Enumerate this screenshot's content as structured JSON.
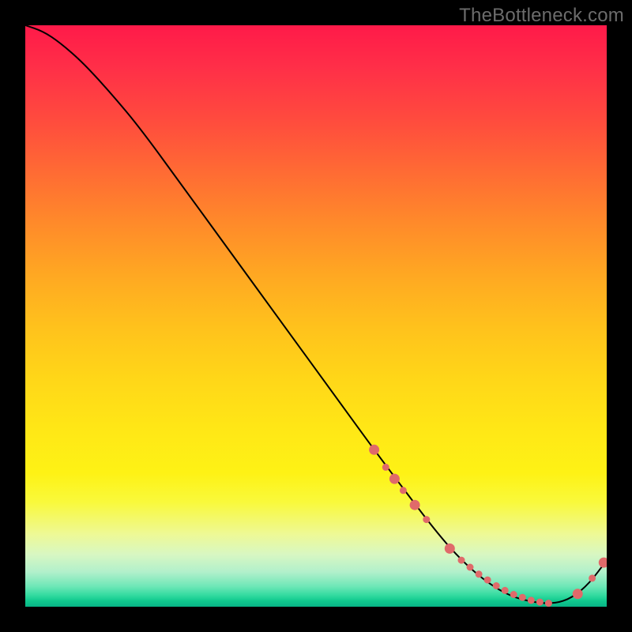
{
  "watermark": "TheBottleneck.com",
  "chart_data": {
    "type": "line",
    "title": "",
    "xlabel": "",
    "ylabel": "",
    "xlim": [
      0,
      100
    ],
    "ylim": [
      0,
      100
    ],
    "curve": {
      "x": [
        0,
        3,
        6,
        10,
        15,
        20,
        28,
        36,
        44,
        52,
        60,
        66,
        71,
        75,
        79,
        83,
        87,
        91,
        94,
        97,
        100
      ],
      "y": [
        100,
        99,
        97,
        93.5,
        88,
        82,
        71,
        60,
        49,
        38,
        27,
        19,
        12.5,
        8,
        4.5,
        2,
        0.8,
        0.5,
        1.5,
        4,
        8
      ]
    },
    "markers": {
      "x": [
        60,
        62,
        63.5,
        65,
        67,
        69,
        73,
        75,
        76.5,
        78,
        79.5,
        81,
        82.5,
        84,
        85.5,
        87,
        88.5,
        90,
        95,
        97.5,
        99.5
      ],
      "y": [
        27,
        24,
        22,
        20,
        17.5,
        15,
        10,
        8,
        6.8,
        5.6,
        4.6,
        3.6,
        2.8,
        2.1,
        1.6,
        1.1,
        0.8,
        0.6,
        2.2,
        4.9,
        7.6
      ],
      "color": "#e06a6a",
      "radius_small": 4.5,
      "radius_large": 6.5,
      "large_indices": [
        0,
        2,
        4,
        6,
        18,
        20
      ]
    },
    "line_color": "#000000",
    "line_width": 2
  }
}
